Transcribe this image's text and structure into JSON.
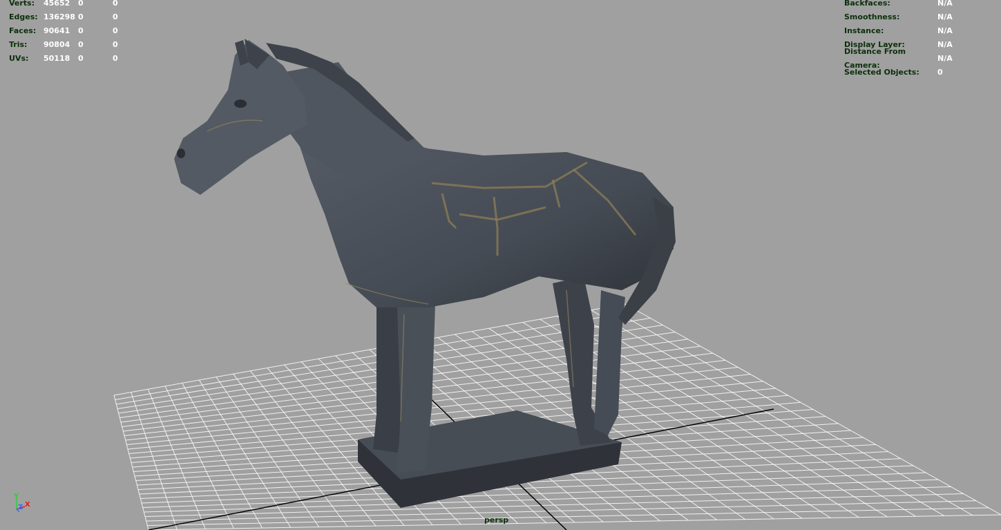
{
  "stats": {
    "rows": [
      {
        "label": "Verts:",
        "v1": "45652",
        "v2": "0",
        "v3": "0"
      },
      {
        "label": "Edges:",
        "v1": "136298",
        "v2": "0",
        "v3": "0"
      },
      {
        "label": "Faces:",
        "v1": "90641",
        "v2": "0",
        "v3": "0"
      },
      {
        "label": "Tris:",
        "v1": "90804",
        "v2": "0",
        "v3": "0"
      },
      {
        "label": "UVs:",
        "v1": "50118",
        "v2": "0",
        "v3": "0"
      }
    ]
  },
  "info": {
    "rows": [
      {
        "label": "Backfaces:",
        "value": "N/A"
      },
      {
        "label": "Smoothness:",
        "value": "N/A"
      },
      {
        "label": "Instance:",
        "value": "N/A"
      },
      {
        "label": "Display Layer:",
        "value": "N/A"
      },
      {
        "label": "Distance From Camera:",
        "value": "N/A"
      },
      {
        "label": "Selected Objects:",
        "value": "0"
      }
    ]
  },
  "camera_label": "persp",
  "axis_gizmo": {
    "y": "Y",
    "z": "Z",
    "x": "X"
  },
  "colors": {
    "viewport_bg": "#a0a0a0",
    "hud_label": "#0b2f0b",
    "hud_value": "#ffffff",
    "grid_line": "#ffffff",
    "axis_line": "#000000",
    "model": "#4a5058",
    "model_highlight": "#8c7d55"
  },
  "model_name": "horse-statue-icon"
}
